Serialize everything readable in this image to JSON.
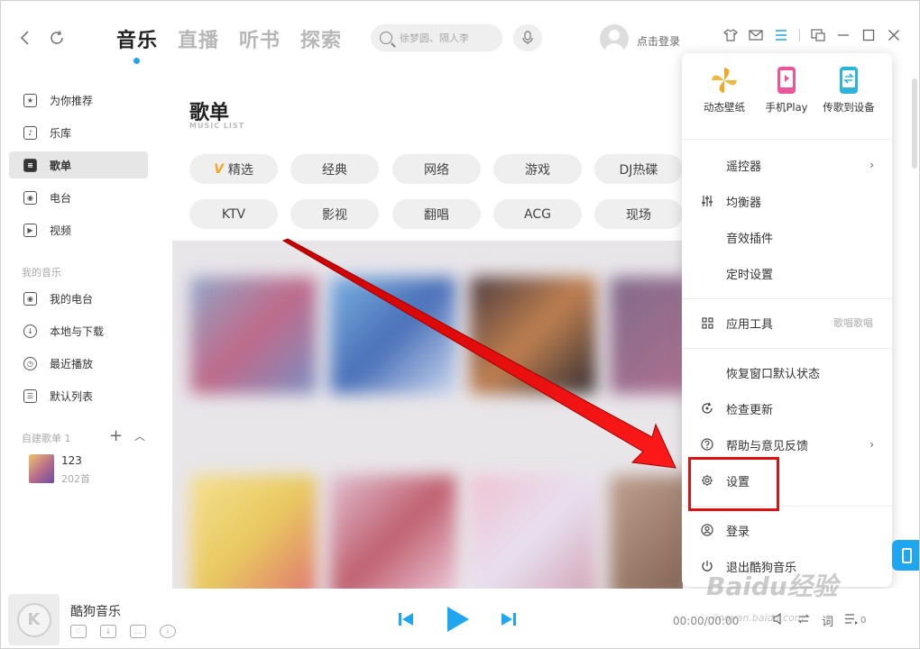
{
  "topbar": {
    "tabs": [
      {
        "label": "音乐",
        "active": true
      },
      {
        "label": "直播",
        "active": false
      },
      {
        "label": "听书",
        "active": false
      },
      {
        "label": "探索",
        "active": false
      }
    ],
    "search_placeholder": "徐梦圆、隔人李",
    "login_text": "点击登录",
    "accent_color": "#1fa6f0"
  },
  "sidebar": {
    "items": [
      {
        "label": "为你推荐",
        "icon": "star-icon",
        "active": false
      },
      {
        "label": "乐库",
        "icon": "music-note-icon",
        "active": false
      },
      {
        "label": "歌单",
        "icon": "playlist-icon",
        "active": true
      },
      {
        "label": "电台",
        "icon": "radio-icon",
        "active": false
      },
      {
        "label": "视频",
        "icon": "video-icon",
        "active": false
      }
    ],
    "my_music_heading": "我的音乐",
    "my_music_items": [
      {
        "label": "我的电台",
        "icon": "radio-icon"
      },
      {
        "label": "本地与下载",
        "icon": "download-icon"
      },
      {
        "label": "最近播放",
        "icon": "clock-icon"
      },
      {
        "label": "默认列表",
        "icon": "list-icon"
      }
    ],
    "custom_heading": "自建歌单 1",
    "playlist": {
      "name": "123",
      "count": "202首"
    }
  },
  "content": {
    "title": "歌单",
    "subtitle": "MUSIC LIST",
    "tags_row1": [
      "精选",
      "经典",
      "网络",
      "游戏",
      "DJ热碟"
    ],
    "tags_row2": [
      "KTV",
      "影视",
      "翻唱",
      "ACG",
      "现场"
    ]
  },
  "menu": {
    "quick": [
      {
        "label": "动态壁纸",
        "icon": "pinwheel-icon"
      },
      {
        "label": "手机Play",
        "icon": "phone-play-icon"
      },
      {
        "label": "传歌到设备",
        "icon": "transfer-device-icon"
      }
    ],
    "items": [
      {
        "label": "遥控器",
        "icon": "",
        "right": "",
        "chevron": true
      },
      {
        "label": "均衡器",
        "icon": "equalizer-icon",
        "right": "",
        "chevron": false
      },
      {
        "label": "音效插件",
        "icon": "",
        "right": "",
        "chevron": false
      },
      {
        "label": "定时设置",
        "icon": "",
        "right": "",
        "chevron": false
      },
      {
        "label": "应用工具",
        "icon": "grid-icon",
        "right": "歌唱歌唱",
        "chevron": false
      },
      {
        "label": "恢复窗口默认状态",
        "icon": "",
        "right": "",
        "chevron": false
      },
      {
        "label": "检查更新",
        "icon": "update-icon",
        "right": "",
        "chevron": false
      },
      {
        "label": "帮助与意见反馈",
        "icon": "help-icon",
        "right": "",
        "chevron": true
      },
      {
        "label": "设置",
        "icon": "gear-icon",
        "right": "",
        "chevron": false
      },
      {
        "label": "登录",
        "icon": "user-icon",
        "right": "",
        "chevron": false
      },
      {
        "label": "退出酷狗音乐",
        "icon": "power-icon",
        "right": "",
        "chevron": false
      }
    ]
  },
  "player": {
    "title": "酷狗音乐",
    "logo_text": "K",
    "time": "00:00/00:00",
    "lyrics_label": "词",
    "queue_count": "0"
  },
  "watermark": {
    "text": "Baidu经验",
    "sub": "jingyan.baidu.com"
  },
  "annotation": {
    "arrow_color": "#e01010",
    "box_color": "#e01010"
  }
}
